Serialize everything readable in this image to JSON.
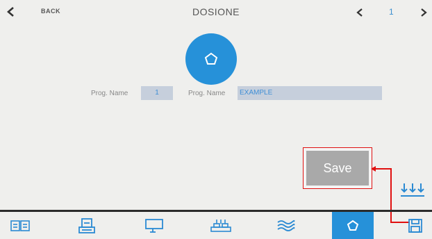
{
  "header": {
    "back_label": "BACK",
    "title": "DOSIONE",
    "page_number": "1"
  },
  "form": {
    "prog_label_1": "Prog. Name",
    "prog_value_1": "1",
    "prog_label_2": "Prog. Name",
    "prog_value_2": "EXAMPLE"
  },
  "annotation": {
    "save_label": "Save",
    "color": "#e01010"
  },
  "colors": {
    "accent": "#2691d9",
    "background": "#efefed"
  },
  "icons": {
    "main": "pentagon-icon",
    "tabs": [
      "book-icon",
      "printer-icon",
      "monitor-icon",
      "rollers-icon",
      "waves-icon",
      "pentagon-icon",
      "save-icon"
    ]
  }
}
